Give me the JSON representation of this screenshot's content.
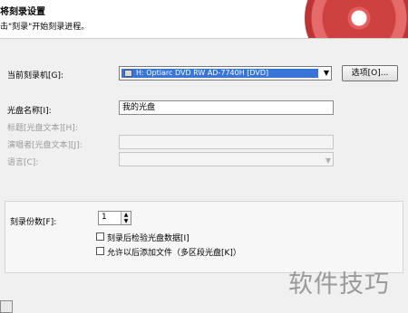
{
  "header": {
    "title": "将刻录设置",
    "subtitle": "击\"刻录\"开始刻录进程。"
  },
  "recorder": {
    "label": "当前刻录机[G]:",
    "value": "H: Optiarc DVD RW AD-7740H   [DVD]",
    "options_button": "选项[O]..."
  },
  "disc_name": {
    "label": "光盘名称[I]:",
    "value": "我的光盘"
  },
  "cd_text": {
    "title_label": "标题[光盘文本][H]:",
    "performer_label": "演唱者[光盘文本][J]:",
    "language_label": "语言[C]:"
  },
  "burn_options": {
    "copies_label": "刻录份数[F]:",
    "copies_value": "1",
    "verify_label": "刻录后检验光盘数据[I]",
    "multisession_label": "允许以后添加文件（多区段光盘[K]）",
    "verify_checked": false,
    "multisession_checked": false
  },
  "watermark": "软件技巧",
  "icons": {
    "drive": "drive-icon",
    "dropdown": "chevron-down-icon",
    "spin_up": "spin-up-icon",
    "spin_down": "spin-down-icon"
  },
  "colors": {
    "selection": "#3875d7",
    "disc": "#c41f1f"
  }
}
